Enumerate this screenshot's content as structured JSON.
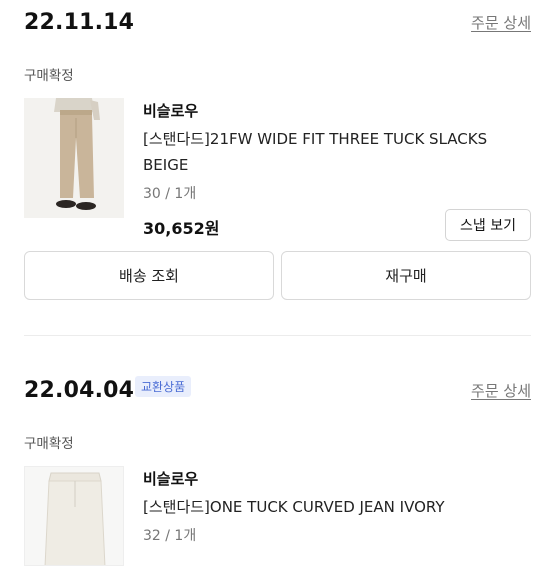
{
  "orders": [
    {
      "date": "22.11.14",
      "detail_link": "주문 상세",
      "status": "구매확정",
      "brand": "비슬로우",
      "product_name": "[스탠다드]21FW WIDE FIT THREE TUCK SLACKS BEIGE",
      "option": "30 / 1개",
      "price": "30,652원",
      "snap_label": "스냅 보기",
      "ship_label": "배송 조회",
      "rebuy_label": "재구매",
      "colors": {
        "product": "#c9b59a"
      }
    },
    {
      "date": "22.04.04",
      "badge": "교환상품",
      "detail_link": "주문 상세",
      "status": "구매확정",
      "brand": "비슬로우",
      "product_name": "[스탠다드]ONE TUCK CURVED JEAN IVORY",
      "option": "32 / 1개",
      "colors": {
        "product": "#ece8df"
      }
    }
  ],
  "colors": {
    "badge_text": "#4a6cd4",
    "badge_bg": "#e9eefc",
    "link": "#777777"
  }
}
